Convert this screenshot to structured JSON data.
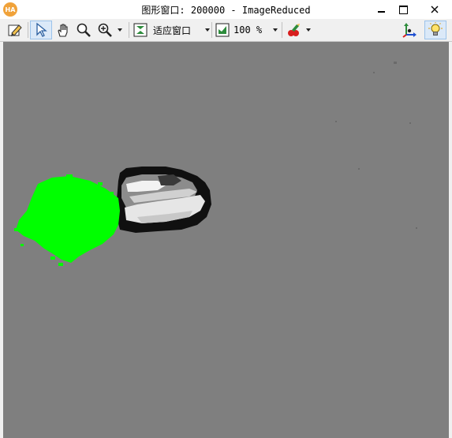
{
  "window": {
    "title": "图形窗口: 200000 - ImageReduced",
    "app_badge": "HA"
  },
  "toolbar": {
    "fit_window_label": "适应窗口",
    "zoom_percent": "100 %"
  },
  "colors": {
    "background_gray": "#7f7f7f",
    "region_overlay": "#00ff00",
    "active_tool_highlight": "#dbe9f8"
  },
  "icons": [
    "edit-draw-icon",
    "pointer-icon",
    "hand-icon",
    "magnifier-icon",
    "zoom-in-icon",
    "fit-window-icon",
    "zoom-percent-icon",
    "color-palette-icon",
    "axis-icon",
    "lightbulb-icon"
  ]
}
